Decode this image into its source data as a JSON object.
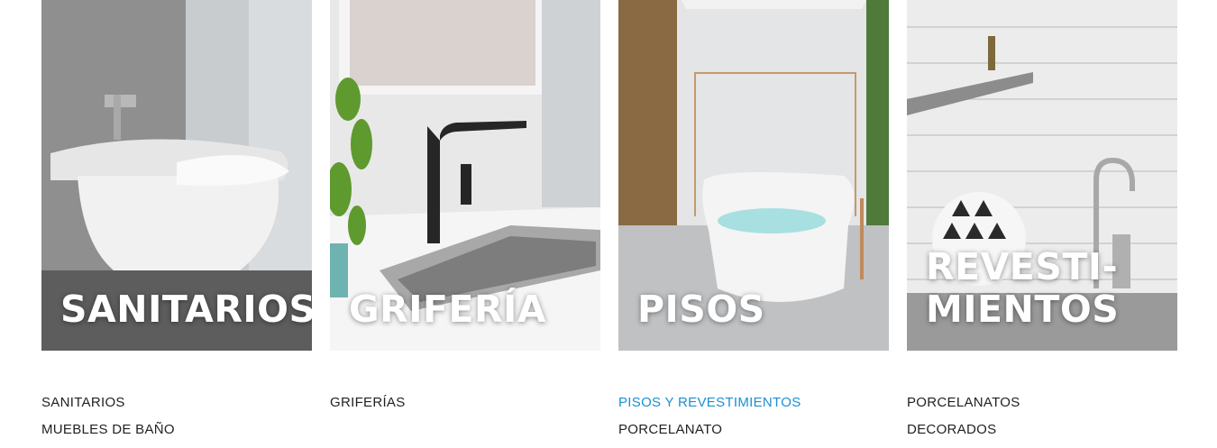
{
  "cards": [
    {
      "title": "SANITARIOS",
      "links": [
        "SANITARIOS",
        "MUEBLES DE BAÑO"
      ]
    },
    {
      "title": "GRIFERÍA",
      "links": [
        "GRIFERÍAS"
      ]
    },
    {
      "title": "PISOS",
      "links": [
        "PISOS Y REVESTIMIENTOS",
        "PORCELANATO"
      ]
    },
    {
      "title": "REVESTI-\nMIENTOS",
      "links": [
        "PORCELANATOS",
        "DECORADOS"
      ]
    }
  ],
  "colors": {
    "link_active": "#1b8fd4",
    "link": "#222222",
    "title": "#ffffff"
  },
  "active_link": "PISOS Y REVESTIMIENTOS"
}
